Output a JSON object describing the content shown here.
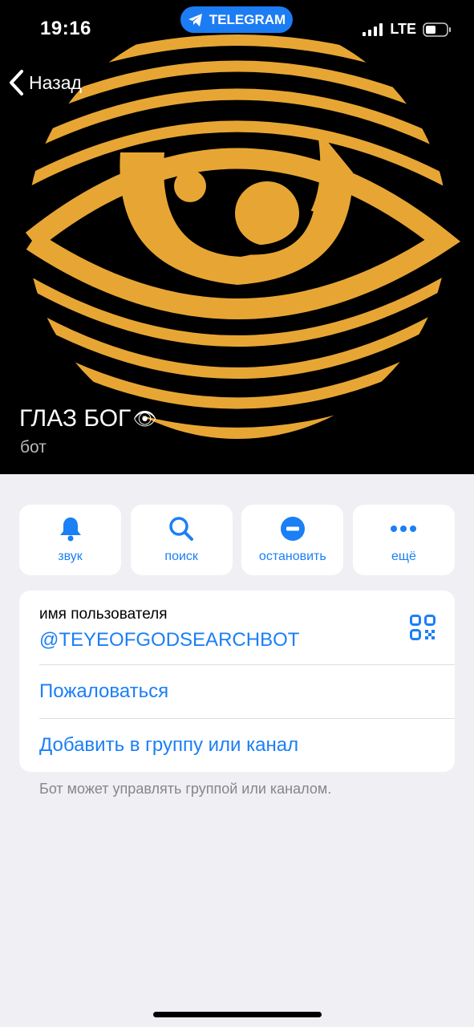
{
  "status_bar": {
    "time": "19:16",
    "app_pill": "TELEGRAM",
    "network": "LTE"
  },
  "nav": {
    "back_label": "Назад"
  },
  "profile": {
    "name": "ГЛАЗ БОГ",
    "name_emoji": "👁",
    "subtitle": "бот"
  },
  "actions": [
    {
      "label": "звук",
      "icon": "bell-icon"
    },
    {
      "label": "поиск",
      "icon": "search-icon"
    },
    {
      "label": "остановить",
      "icon": "stop-icon"
    },
    {
      "label": "ещё",
      "icon": "more-icon"
    }
  ],
  "info": {
    "username_caption": "имя пользователя",
    "username": "@TEYEOFGODSEARCHBOT",
    "report_label": "Пожаловаться",
    "add_label": "Добавить в группу или канал",
    "footnote": "Бот может управлять группой или каналом."
  },
  "colors": {
    "accent": "#1b7ff5",
    "logo_gold": "#e7a634",
    "background": "#efeff4"
  }
}
